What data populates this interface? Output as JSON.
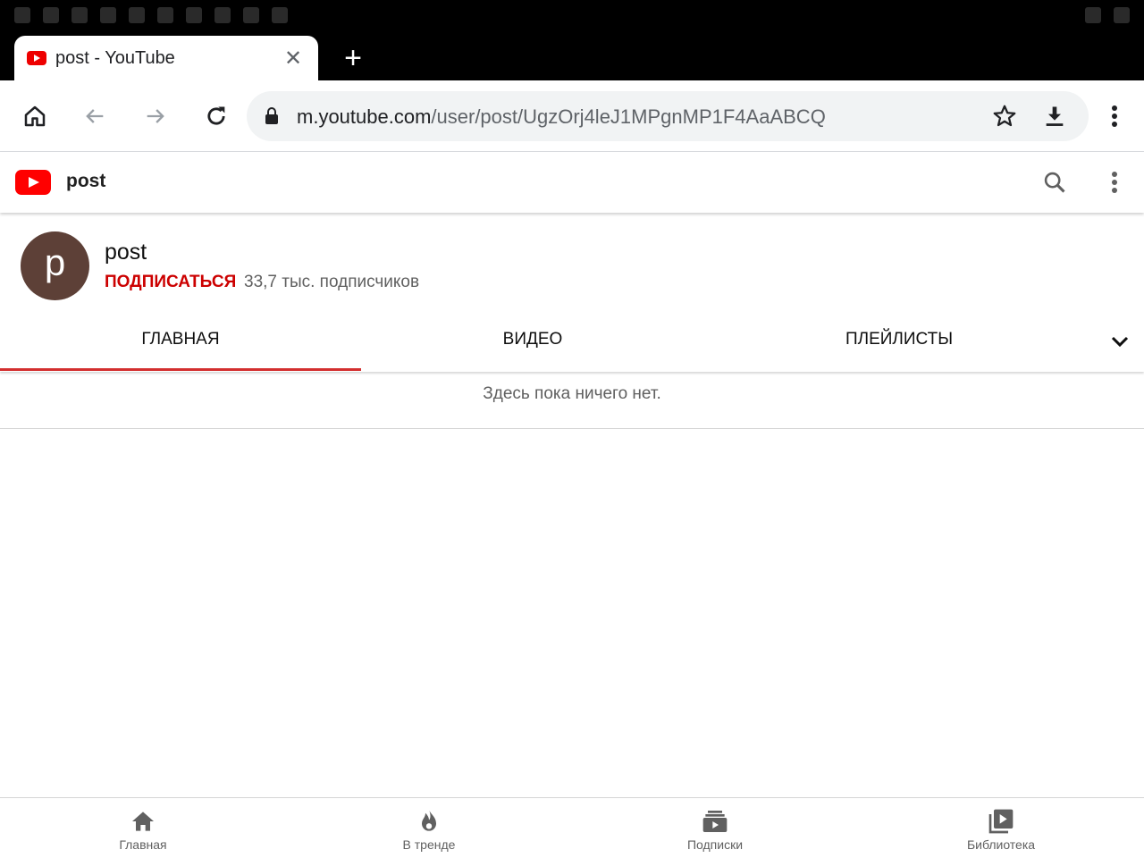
{
  "browser": {
    "tab_title": "post - YouTube",
    "url_host": "m.youtube.com",
    "url_path": "/user/post/UgzOrj4leJ1MPgnMP1F4AaABCQ",
    "icons": [
      "home-icon",
      "back-icon",
      "forward-icon",
      "reload-icon",
      "lock-icon",
      "star-icon",
      "download-icon",
      "more-vert-icon"
    ]
  },
  "header": {
    "title": "post"
  },
  "channel": {
    "avatar_letter": "p",
    "name": "post",
    "subscribe_label": "ПОДПИСАТЬСЯ",
    "subscriber_count": "33,7 тыс. подписчиков",
    "avatar_color": "#5d4037",
    "subscribe_color": "#cc0000"
  },
  "tabs": [
    {
      "label": "ГЛАВНАЯ",
      "active": true
    },
    {
      "label": "ВИДЕО",
      "active": false
    },
    {
      "label": "ПЛЕЙЛИСТЫ",
      "active": false
    }
  ],
  "content": {
    "empty_message": "Здесь пока ничего нет."
  },
  "bottom_nav": [
    {
      "label": "Главная",
      "icon": "home-icon"
    },
    {
      "label": "В тренде",
      "icon": "trending-fire-icon"
    },
    {
      "label": "Подписки",
      "icon": "subscriptions-icon"
    },
    {
      "label": "Библиотека",
      "icon": "library-icon"
    }
  ],
  "colors": {
    "youtube_red": "#ff0000",
    "active_tab_underline": "#d32f2f"
  }
}
